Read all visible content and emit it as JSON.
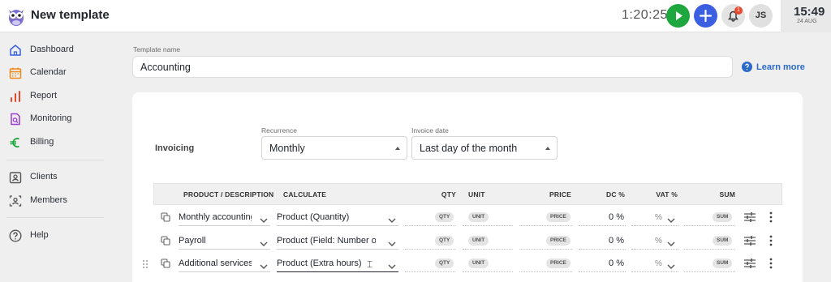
{
  "header": {
    "app_title": "New template",
    "timer": "1:20:25",
    "avatar_initials": "JS",
    "notification_count": "1",
    "clock_time": "15:49",
    "clock_date": "24 AUG"
  },
  "sidebar": {
    "items": [
      {
        "label": "Dashboard",
        "icon": "home-icon",
        "color": "#3b5fe0"
      },
      {
        "label": "Calendar",
        "icon": "calendar-icon",
        "color": "#f08a1c"
      },
      {
        "label": "Report",
        "icon": "bar-chart-icon",
        "color": "#e8492c"
      },
      {
        "label": "Monitoring",
        "icon": "monitoring-icon",
        "color": "#9b3fd1"
      },
      {
        "label": "Billing",
        "icon": "euro-icon",
        "color": "#1ea73f"
      },
      {
        "label": "Clients",
        "icon": "id-card-icon",
        "color": "#555555"
      },
      {
        "label": "Members",
        "icon": "members-icon",
        "color": "#555555"
      },
      {
        "label": "Help",
        "icon": "help-icon",
        "color": "#555555"
      }
    ]
  },
  "template": {
    "name_label": "Template name",
    "name_value": "Accounting",
    "learn_more": "Learn more"
  },
  "invoicing": {
    "label": "Invoicing",
    "recurrence_label": "Recurrence",
    "recurrence_value": "Monthly",
    "invoice_date_label": "Invoice date",
    "invoice_date_value": "Last day of the month"
  },
  "table": {
    "headers": [
      "PRODUCT / DESCRIPTION",
      "CALCULATE",
      "QTY",
      "UNIT",
      "PRICE",
      "DC %",
      "VAT %",
      "SUM"
    ],
    "rows": [
      {
        "product": "Monthly accounting",
        "calculate": "Product (Quantity)",
        "qty": "QTY",
        "unit": "UNIT",
        "price": "PRICE",
        "dc": "0 %",
        "vat": "%",
        "sum": "SUM"
      },
      {
        "product": "Payroll",
        "calculate": "Product (Field: Number of",
        "qty": "QTY",
        "unit": "UNIT",
        "price": "PRICE",
        "dc": "0 %",
        "vat": "%",
        "sum": "SUM"
      },
      {
        "product": "Additional services",
        "calculate": "Product (Extra hours)",
        "qty": "QTY",
        "unit": "UNIT",
        "price": "PRICE",
        "dc": "0 %",
        "vat": "%",
        "sum": "SUM"
      }
    ]
  },
  "colors": {
    "accent_blue": "#3b5fe0",
    "play_green": "#1ea73f",
    "badge_red": "#e8492c",
    "link_blue": "#2a69c9"
  }
}
